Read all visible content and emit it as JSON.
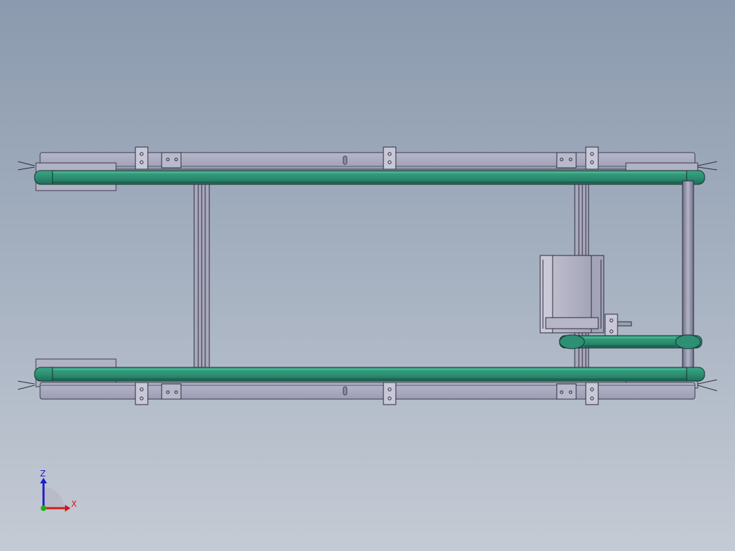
{
  "triad": {
    "z_label": "Z",
    "x_label": "X",
    "z_color": "#1c1cc8",
    "x_color": "#d01818",
    "y_color": "#18b018"
  },
  "colors": {
    "belt": "#2d8f73",
    "belt_dark": "#1d6a55",
    "frame": "#a8a8be",
    "frame_dark": "#6e6e86",
    "motor": "#b3b3c4",
    "line": "#2a2a3a"
  },
  "parts": {
    "belts": [
      "top-conveyor-belt",
      "bottom-conveyor-belt",
      "drive-belt"
    ],
    "motor": "stepper-motor",
    "shaft": "drive-shaft"
  }
}
